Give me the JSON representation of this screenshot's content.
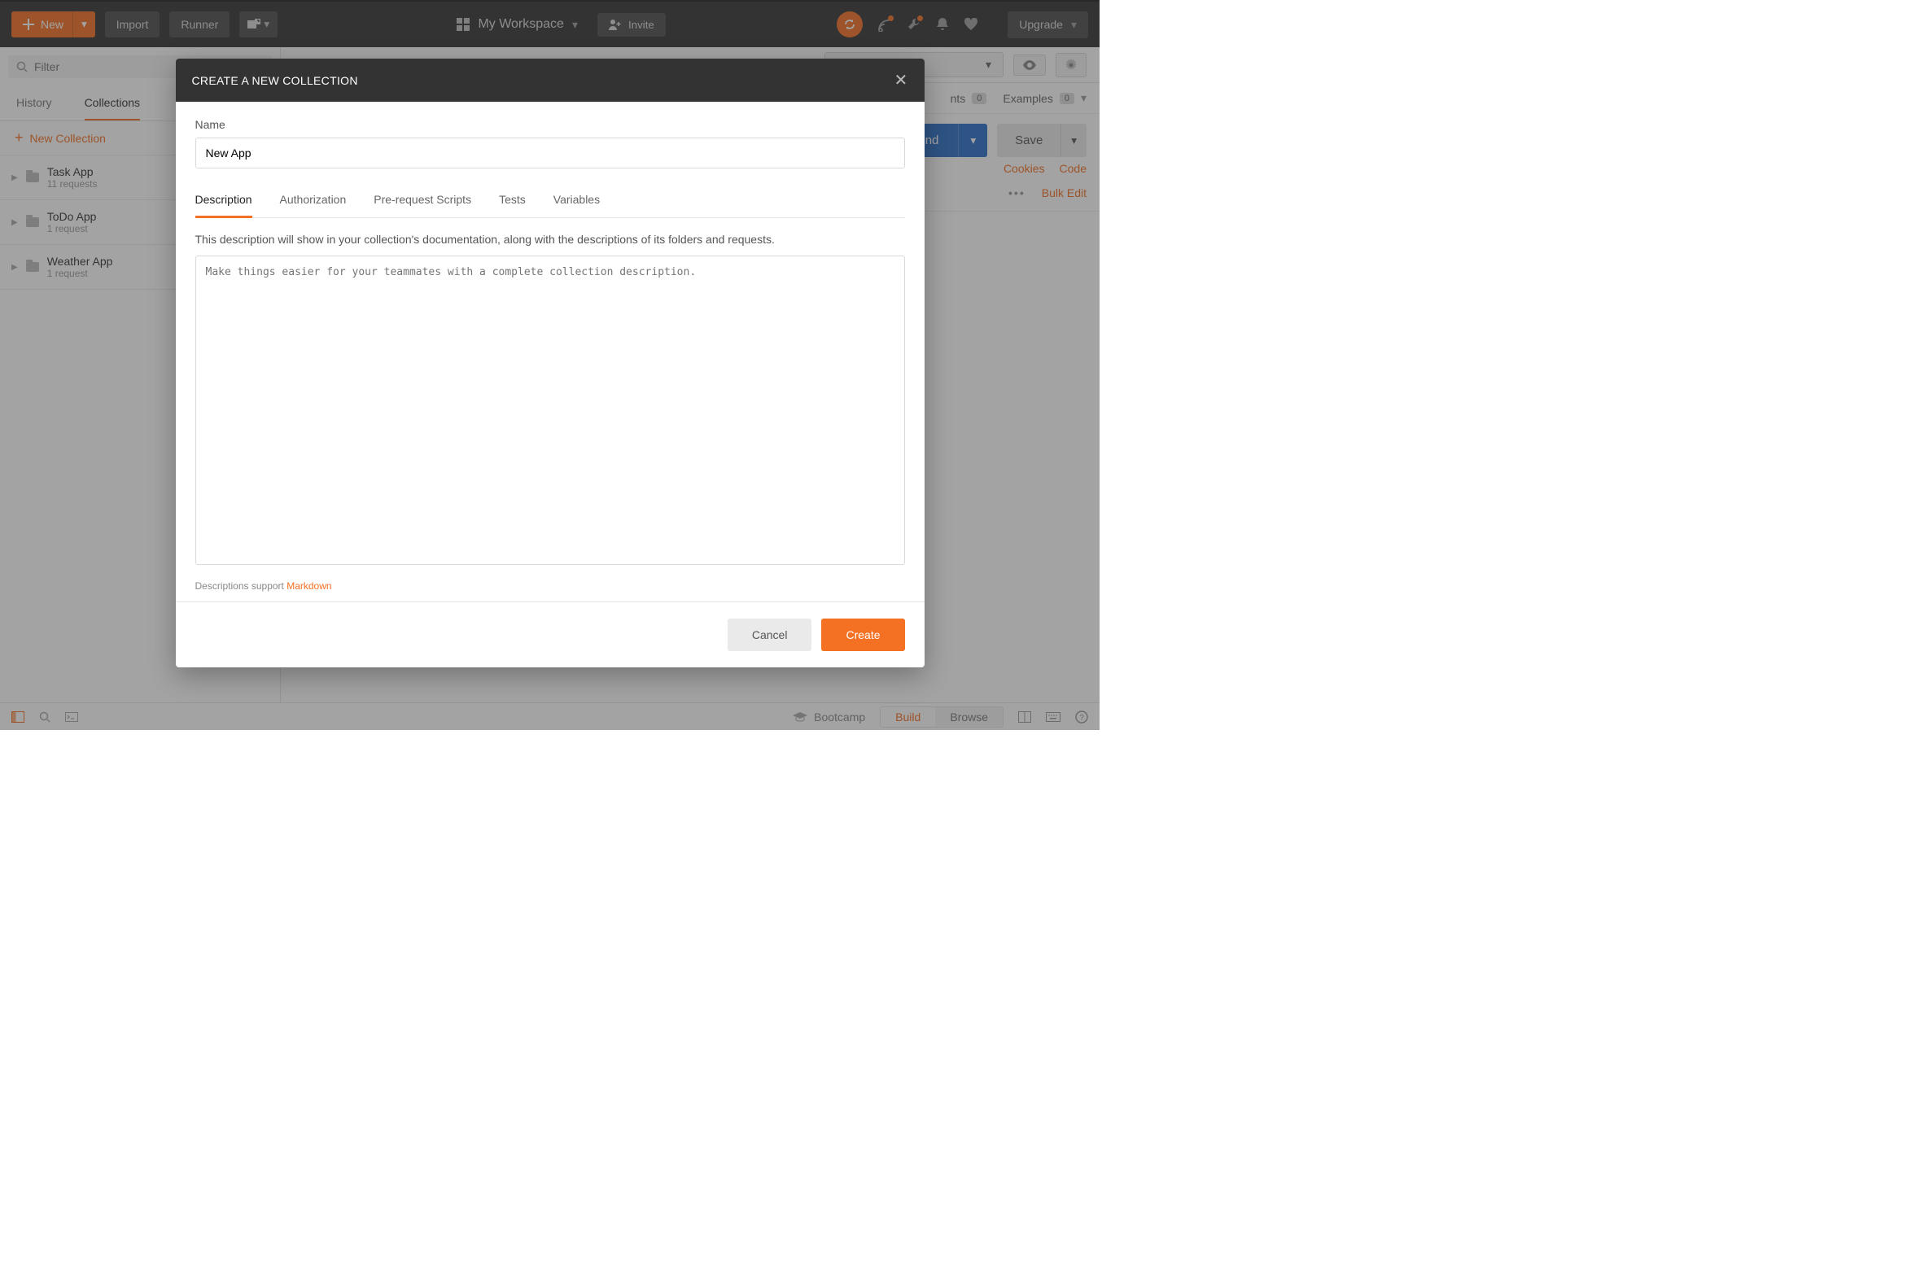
{
  "topbar": {
    "new_label": "New",
    "import_label": "Import",
    "runner_label": "Runner",
    "workspace_label": "My Workspace",
    "invite_label": "Invite",
    "upgrade_label": "Upgrade"
  },
  "sidebar": {
    "filter_placeholder": "Filter",
    "tab_history": "History",
    "tab_collections": "Collections",
    "new_collection_label": "New Collection",
    "collections": [
      {
        "title": "Task App",
        "sub": "11 requests"
      },
      {
        "title": "ToDo App",
        "sub": "1 request"
      },
      {
        "title": "Weather App",
        "sub": "1 request"
      }
    ]
  },
  "content": {
    "comments_label": "nts",
    "comments_count": "0",
    "examples_label": "Examples",
    "examples_count": "0",
    "send_label": "Send",
    "save_label": "Save",
    "cookies_label": "Cookies",
    "code_label": "Code",
    "bulk_edit_label": "Bulk Edit"
  },
  "statusbar": {
    "bootcamp_label": "Bootcamp",
    "build_label": "Build",
    "browse_label": "Browse"
  },
  "modal": {
    "title": "CREATE A NEW COLLECTION",
    "name_label": "Name",
    "name_value": "New App",
    "tabs": {
      "description": "Description",
      "authorization": "Authorization",
      "prerequest": "Pre-request Scripts",
      "tests": "Tests",
      "variables": "Variables"
    },
    "description_hint": "This description will show in your collection's documentation, along with the descriptions of its folders and requests.",
    "textarea_placeholder": "Make things easier for your teammates with a complete collection description.",
    "md_note_prefix": "Descriptions support ",
    "md_link_label": "Markdown",
    "cancel_label": "Cancel",
    "create_label": "Create"
  }
}
